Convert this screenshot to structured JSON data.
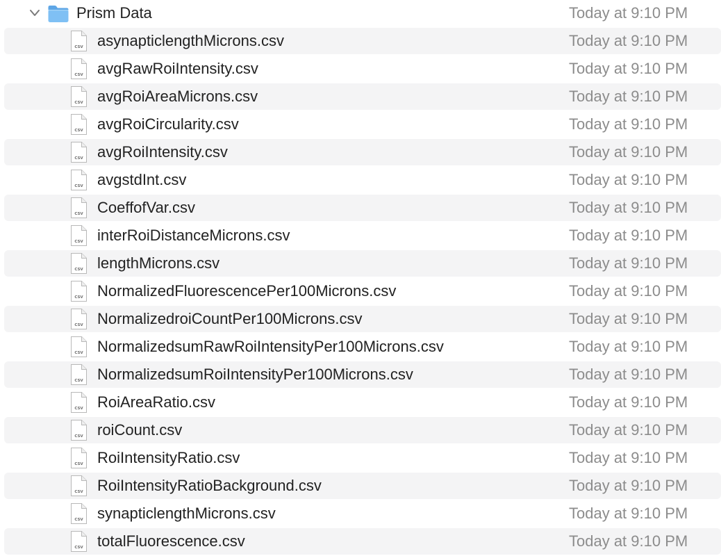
{
  "folder": {
    "name": "Prism Data",
    "date": "Today at 9:10 PM",
    "icon": "folder-icon",
    "expanded": true,
    "accent": "#6fb4ee"
  },
  "file_icon": {
    "name": "csv-file-icon",
    "badge": "CSV"
  },
  "files": [
    {
      "name": "asynapticlengthMicrons.csv",
      "date": "Today at 9:10 PM"
    },
    {
      "name": "avgRawRoiIntensity.csv",
      "date": "Today at 9:10 PM"
    },
    {
      "name": "avgRoiAreaMicrons.csv",
      "date": "Today at 9:10 PM"
    },
    {
      "name": "avgRoiCircularity.csv",
      "date": "Today at 9:10 PM"
    },
    {
      "name": "avgRoiIntensity.csv",
      "date": "Today at 9:10 PM"
    },
    {
      "name": "avgstdInt.csv",
      "date": "Today at 9:10 PM"
    },
    {
      "name": "CoeffofVar.csv",
      "date": "Today at 9:10 PM"
    },
    {
      "name": "interRoiDistanceMicrons.csv",
      "date": "Today at 9:10 PM"
    },
    {
      "name": "lengthMicrons.csv",
      "date": "Today at 9:10 PM"
    },
    {
      "name": "NormalizedFluorescencePer100Microns.csv",
      "date": "Today at 9:10 PM"
    },
    {
      "name": "NormalizedroiCountPer100Microns.csv",
      "date": "Today at 9:10 PM"
    },
    {
      "name": "NormalizedsumRawRoiIntensityPer100Microns.csv",
      "date": "Today at 9:10 PM"
    },
    {
      "name": "NormalizedsumRoiIntensityPer100Microns.csv",
      "date": "Today at 9:10 PM"
    },
    {
      "name": "RoiAreaRatio.csv",
      "date": "Today at 9:10 PM"
    },
    {
      "name": "roiCount.csv",
      "date": "Today at 9:10 PM"
    },
    {
      "name": "RoiIntensityRatio.csv",
      "date": "Today at 9:10 PM"
    },
    {
      "name": "RoiIntensityRatioBackground.csv",
      "date": "Today at 9:10 PM"
    },
    {
      "name": "synapticlengthMicrons.csv",
      "date": "Today at 9:10 PM"
    },
    {
      "name": "totalFluorescence.csv",
      "date": "Today at 9:10 PM"
    }
  ]
}
